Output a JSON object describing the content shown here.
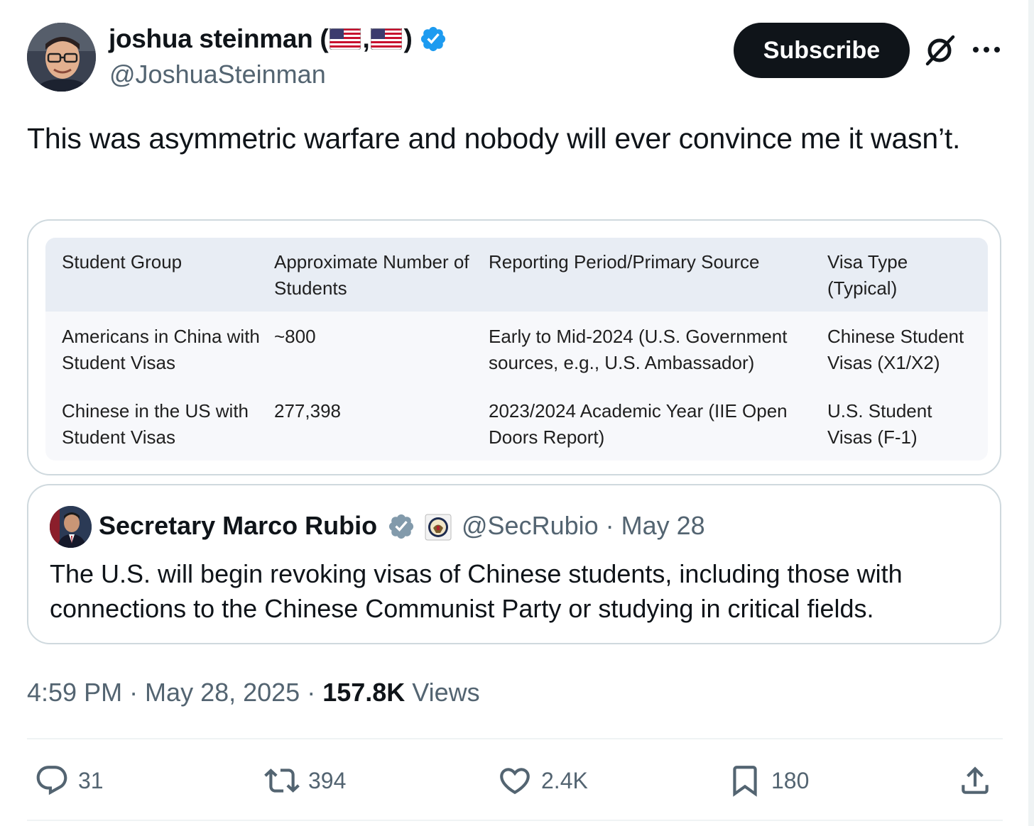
{
  "author": {
    "display_name": "joshua steinman (",
    "display_name_sep": ",",
    "display_name_end": ")",
    "handle": "@JoshuaSteinman"
  },
  "header": {
    "subscribe_label": "Subscribe"
  },
  "tweet": {
    "text": "This was asymmetric warfare and nobody will ever convince me it wasn’t."
  },
  "table": {
    "headers": [
      "Student Group",
      "Approximate Number of Students",
      "Reporting Period/Primary Source",
      "Visa Type (Typical)"
    ],
    "rows": [
      [
        "Americans in China with Student Visas",
        "~800",
        "Early to Mid-2024 (U.S. Government sources, e.g., U.S. Ambassador)",
        "Chinese Student Visas (X1/X2)"
      ],
      [
        "Chinese in the US with Student Visas",
        "277,398",
        "2023/2024 Academic Year (IIE Open Doors Report)",
        "U.S. Student Visas (F-1)"
      ]
    ]
  },
  "quote": {
    "name": "Secretary Marco Rubio",
    "handle_date": "@SecRubio · May 28",
    "text": "The U.S. will begin revoking visas of Chinese students, including those with connections to the Chinese Communist Party or studying in critical fields."
  },
  "meta": {
    "time_date": "4:59 PM · May 28, 2025 · ",
    "views_count": "157.8K",
    "views_label": " Views"
  },
  "actions": {
    "replies": "31",
    "reposts": "394",
    "likes": "2.4K",
    "bookmarks": "180"
  },
  "colors": {
    "text_primary": "#0f1419",
    "text_secondary": "#536471",
    "verified_blue": "#1d9bf0",
    "verified_gray": "#829aab",
    "border": "#cfd9de"
  }
}
